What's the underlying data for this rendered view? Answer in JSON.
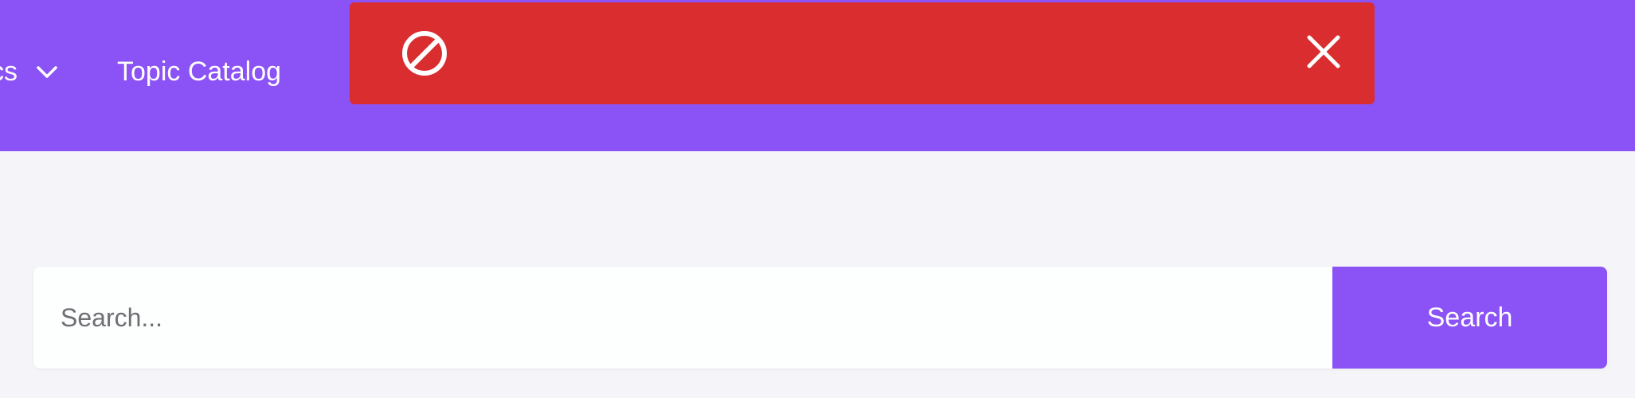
{
  "colors": {
    "brand": "#8b52f6",
    "error": "#d92d2f",
    "page_background": "#f5f5f9",
    "text_on_brand": "#ffffff"
  },
  "nav": {
    "items": [
      {
        "label": "cs",
        "icon": "chevron-down-icon"
      },
      {
        "label": "Topic Catalog"
      }
    ]
  },
  "toast": {
    "icon": "ban-icon",
    "message": "",
    "close_icon": "close-icon"
  },
  "search": {
    "placeholder": "Search...",
    "value": "",
    "button_label": "Search"
  }
}
